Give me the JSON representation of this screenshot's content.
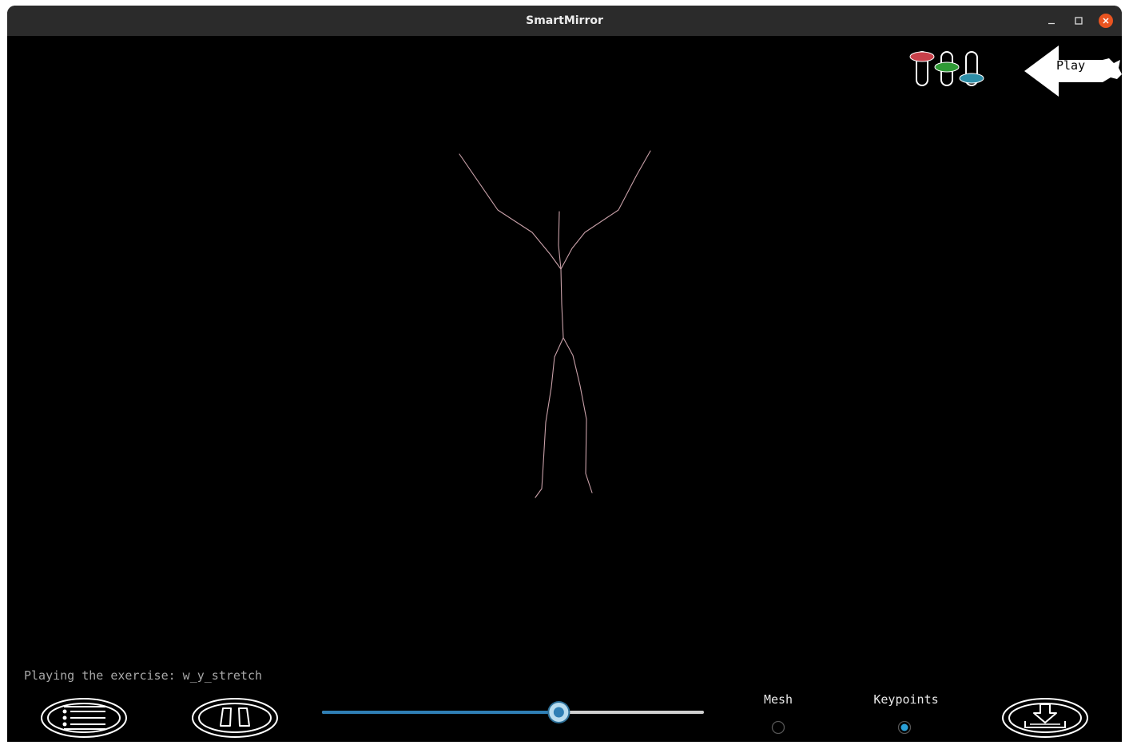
{
  "window": {
    "title": "SmartMirror"
  },
  "status": {
    "text": "Playing the exercise: w_y_stretch"
  },
  "playback": {
    "progress": 0.62,
    "play_label": "Play"
  },
  "view_mode": {
    "mesh_label": "Mesh",
    "keypoints_label": "Keypoints",
    "selected": "keypoints"
  },
  "icons": {
    "list": "list-icon",
    "pause": "pause-icon",
    "download": "download-icon",
    "equalizer": "equalizer-icon",
    "play_arrow": "arrow-left-icon"
  },
  "colors": {
    "accent": "#2f7fb5",
    "skeleton": "#c8a0a8",
    "eq_red": "#c8404a",
    "eq_green": "#2f9a36",
    "eq_teal": "#2f8fa8"
  }
}
